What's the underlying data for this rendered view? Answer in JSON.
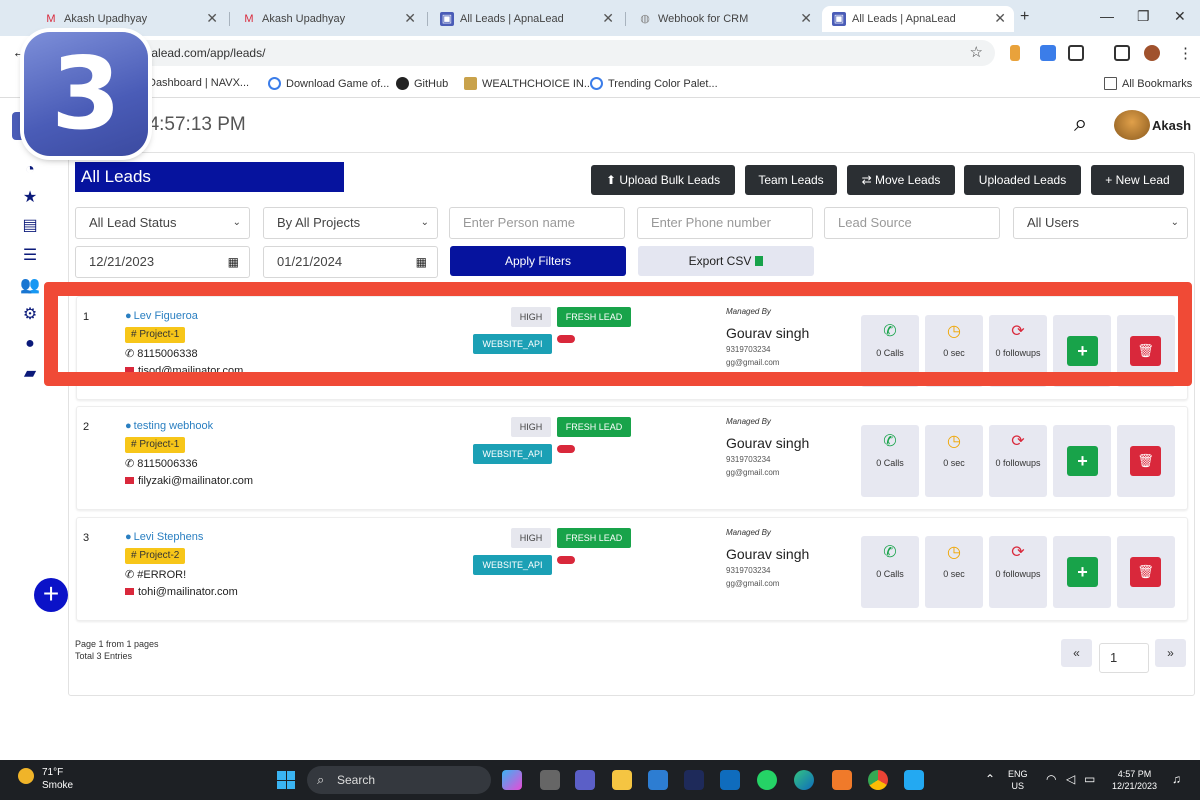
{
  "browser": {
    "tabs": [
      {
        "title": "Akash Upadhyay"
      },
      {
        "title": "Akash Upadhyay"
      },
      {
        "title": "All Leads | ApnaLead"
      },
      {
        "title": "Webhook for CRM"
      },
      {
        "title": "All Leads | ApnaLead"
      }
    ],
    "new_tab": "+",
    "url": "...c.apnalead.com/app/leads/",
    "bookmarks": [
      {
        "label": "Dashboard | NAVX..."
      },
      {
        "label": "Download Game of..."
      },
      {
        "label": "GitHub"
      },
      {
        "label": "WEALTHCHOICE IN..."
      },
      {
        "label": "Trending Color Palet..."
      },
      {
        "label": "All Bookmarks"
      }
    ]
  },
  "overlay": {
    "step": "3"
  },
  "header": {
    "clock": "04:57:13 PM",
    "user": "Akash"
  },
  "page": {
    "title": "All Leads",
    "buttons": {
      "upload_bulk": "Upload Bulk Leads",
      "team_leads": "Team Leads",
      "move_leads": "Move Leads",
      "uploaded_leads": "Uploaded Leads",
      "new_lead": "New Lead"
    },
    "filters": {
      "lead_status": "All Lead Status",
      "projects": "By All Projects",
      "person_placeholder": "Enter Person name",
      "phone_placeholder": "Enter Phone number",
      "source_placeholder": "Lead Source",
      "users": "All Users",
      "date_from": "12/21/2023",
      "date_to": "01/21/2024",
      "apply": "Apply Filters",
      "export": "Export CSV"
    }
  },
  "leads": [
    {
      "num": "1",
      "name": "Lev Figueroa",
      "project": "# Project-1",
      "phone": "8115006338",
      "email": "tisod@mailinator.com",
      "priority": "HIGH",
      "status": "FRESH LEAD",
      "source": "WEBSITE_API",
      "managed_label": "Managed By",
      "manager": "Gourav singh",
      "manager_phone": "9319703234",
      "manager_email": "gg@gmail.com",
      "calls": "0 Calls",
      "duration": "0 sec",
      "followups": "0 followups"
    },
    {
      "num": "2",
      "name": "testing webhook",
      "project": "# Project-1",
      "phone": "8115006336",
      "email": "filyzaki@mailinator.com",
      "priority": "HIGH",
      "status": "FRESH LEAD",
      "source": "WEBSITE_API",
      "managed_label": "Managed By",
      "manager": "Gourav singh",
      "manager_phone": "9319703234",
      "manager_email": "gg@gmail.com",
      "calls": "0 Calls",
      "duration": "0 sec",
      "followups": "0 followups"
    },
    {
      "num": "3",
      "name": "Levi Stephens",
      "project": "# Project-2",
      "phone": "#ERROR!",
      "email": "tohi@mailinator.com",
      "priority": "HIGH",
      "status": "FRESH LEAD",
      "source": "WEBSITE_API",
      "managed_label": "Managed By",
      "manager": "Gourav singh",
      "manager_phone": "9319703234",
      "manager_email": "gg@gmail.com",
      "calls": "0 Calls",
      "duration": "0 sec",
      "followups": "0 followups"
    }
  ],
  "pagination": {
    "info": "Page 1 from 1 pages",
    "total": "Total 3 Entries",
    "prev": "«",
    "current": "1",
    "next": "»"
  },
  "taskbar": {
    "weather_temp": "71°F",
    "weather_desc": "Smoke",
    "search": "Search",
    "lang": "ENG",
    "region": "US",
    "time": "4:57 PM",
    "date": "12/21/2023"
  },
  "colors": {
    "brand": "#06139e",
    "highlight": "#f04a36",
    "green": "#18a34a",
    "red": "#d9283b",
    "teal": "#1ba0b5",
    "yellow": "#f7c619"
  }
}
